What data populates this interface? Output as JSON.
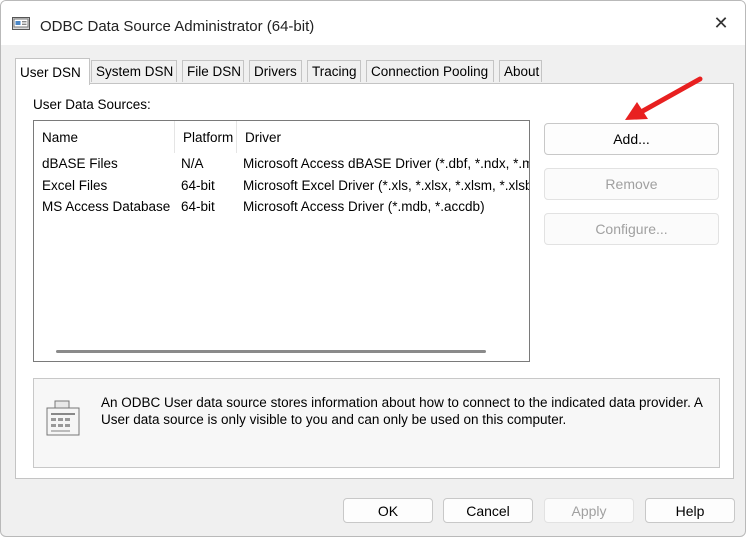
{
  "window": {
    "title": "ODBC Data Source Administrator (64-bit)",
    "close_glyph": "✕"
  },
  "tabs": [
    {
      "label": "User DSN",
      "active": true
    },
    {
      "label": "System DSN",
      "active": false
    },
    {
      "label": "File DSN",
      "active": false
    },
    {
      "label": "Drivers",
      "active": false
    },
    {
      "label": "Tracing",
      "active": false
    },
    {
      "label": "Connection Pooling",
      "active": false
    },
    {
      "label": "About",
      "active": false
    }
  ],
  "panel": {
    "sources_label": "User Data Sources:",
    "columns": [
      "Name",
      "Platform",
      "Driver"
    ],
    "rows": [
      {
        "name": "dBASE Files",
        "platform": "N/A",
        "driver": "Microsoft Access dBASE Driver (*.dbf, *.ndx, *.m"
      },
      {
        "name": "Excel Files",
        "platform": "64-bit",
        "driver": "Microsoft Excel Driver (*.xls, *.xlsx, *.xlsm, *.xlsb)"
      },
      {
        "name": "MS Access Database",
        "platform": "64-bit",
        "driver": "Microsoft Access Driver (*.mdb, *.accdb)"
      }
    ],
    "buttons": {
      "add": "Add...",
      "remove": "Remove",
      "configure": "Configure..."
    },
    "info_text": "An ODBC User data source stores information about how to connect to the indicated data provider.  A User data source is only visible to you and can only be used on this computer."
  },
  "footer": {
    "ok": "OK",
    "cancel": "Cancel",
    "apply": "Apply",
    "help": "Help"
  },
  "colors": {
    "annotation_arrow": "#e82020"
  },
  "icons": {
    "title": "odbc-app-icon",
    "info": "database-info-icon",
    "annotation": "red-arrow-icon"
  }
}
